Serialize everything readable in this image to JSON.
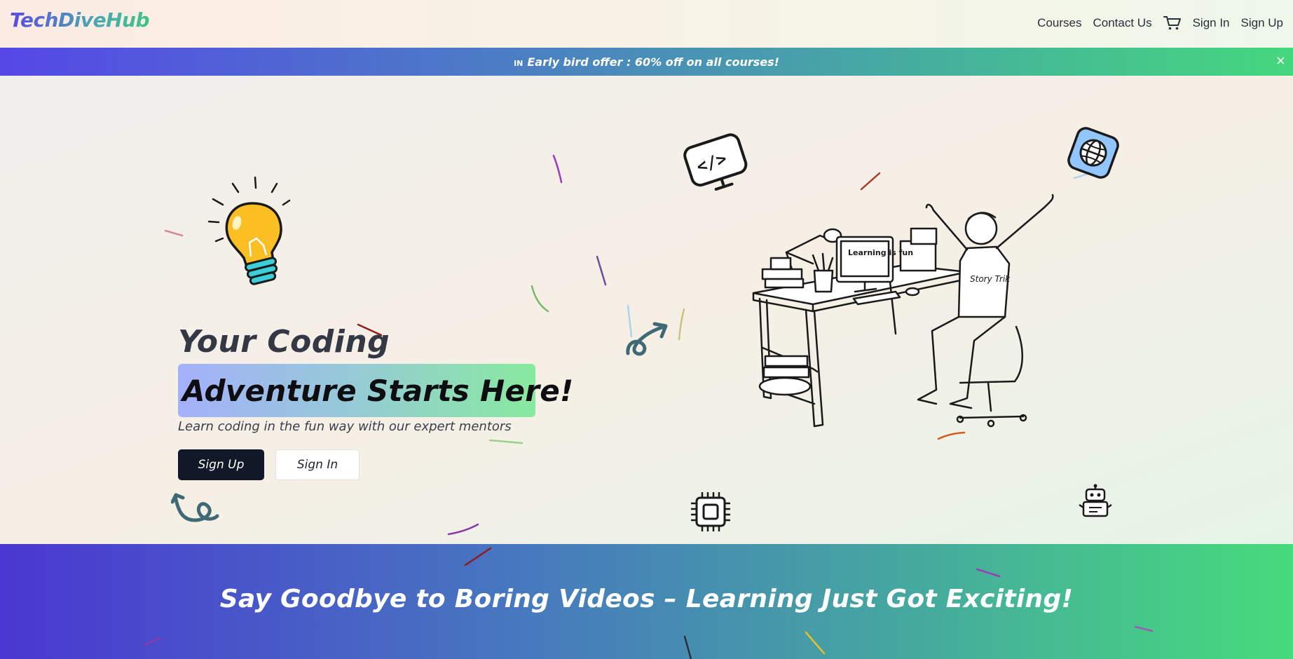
{
  "header": {
    "logo": "TechDiveHub",
    "nav": {
      "courses": "Courses",
      "contact": "Contact Us",
      "cart_icon": "cart-icon",
      "sign_in": "Sign In",
      "sign_up": "Sign Up"
    }
  },
  "promo": {
    "flag": "IN",
    "text": "Early bird offer : 60% off on all courses!",
    "close": "×"
  },
  "hero": {
    "title_line1": "Your Coding",
    "title_line2": "Adventure Starts Here!",
    "subtitle": "Learn coding in the fun way with our expert mentors",
    "primary_button": "Sign Up",
    "secondary_button": "Sign In",
    "illustration": {
      "monitor_text": "Learning is fun",
      "shirt_text": "Story Trik"
    },
    "icons": [
      "lightbulb-icon",
      "code-monitor-icon",
      "globe-icon",
      "cpu-chip-icon",
      "robot-icon",
      "curly-arrow-icon"
    ]
  },
  "tagline": "Say Goodbye to Boring Videos – Learning Just Got Exciting!",
  "colors": {
    "primary_dark": "#111827",
    "brand_purple": "#5548e6",
    "brand_green": "#45d77d",
    "bulb_yellow": "#fbbf24",
    "bulb_base": "#3ccfd8"
  }
}
